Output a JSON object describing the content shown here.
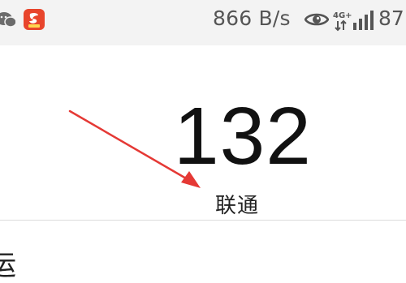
{
  "status_bar": {
    "net_speed": "866 B/s",
    "network_type": "4G+",
    "battery": "87",
    "icons": [
      "wechat-icon",
      "red-app-icon",
      "eye-icon",
      "signal-icon"
    ]
  },
  "main": {
    "number": "132",
    "carrier": "联通",
    "partial_label": "运"
  },
  "colors": {
    "arrow": "#e53935",
    "status_bar_bg": "#f3f3f3",
    "app_icon": "#e8452c"
  }
}
